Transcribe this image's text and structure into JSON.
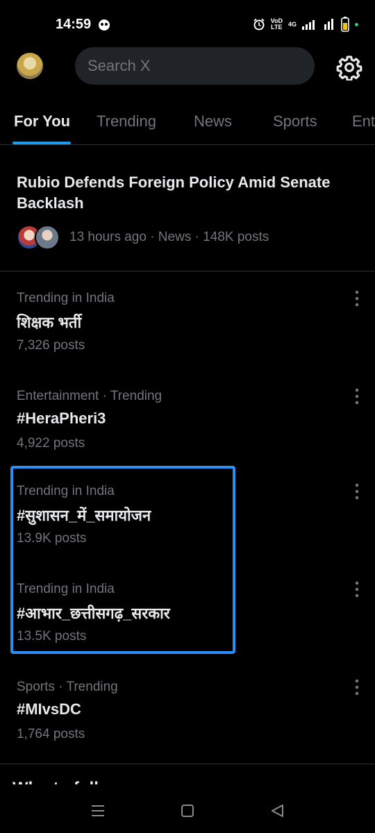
{
  "status_bar": {
    "time": "14:59",
    "network_label_top": "VoD",
    "network_label_bottom": "LTE",
    "network_type": "4G"
  },
  "header": {
    "search_placeholder": "Search X"
  },
  "tabs": [
    "For You",
    "Trending",
    "News",
    "Sports",
    "Ent"
  ],
  "headline": {
    "title": "Rubio Defends Foreign Policy Amid Senate Backlash",
    "meta": "13 hours ago · News · 148K posts"
  },
  "trends": [
    {
      "context": "Trending in India",
      "title": "शिक्षक भर्ती",
      "count": "7,326 posts"
    },
    {
      "context": "Entertainment · Trending",
      "title": "#HeraPheri3",
      "count": "4,922 posts"
    },
    {
      "context": "Trending in India",
      "title": "#सुशासन_में_समायोजन",
      "count": "13.9K posts"
    },
    {
      "context": "Trending in India",
      "title": "#आभार_छत्तीसगढ़_सरकार",
      "count": "13.5K posts"
    },
    {
      "context": "Sports · Trending",
      "title": "#MIvsDC",
      "count": "1,764 posts"
    }
  ],
  "section": {
    "who_to_follow": "Who to follow"
  },
  "colors": {
    "accent": "#1d9bf0",
    "highlight_border": "#2a8ff5",
    "background": "#000000",
    "text_secondary": "#71767b"
  }
}
